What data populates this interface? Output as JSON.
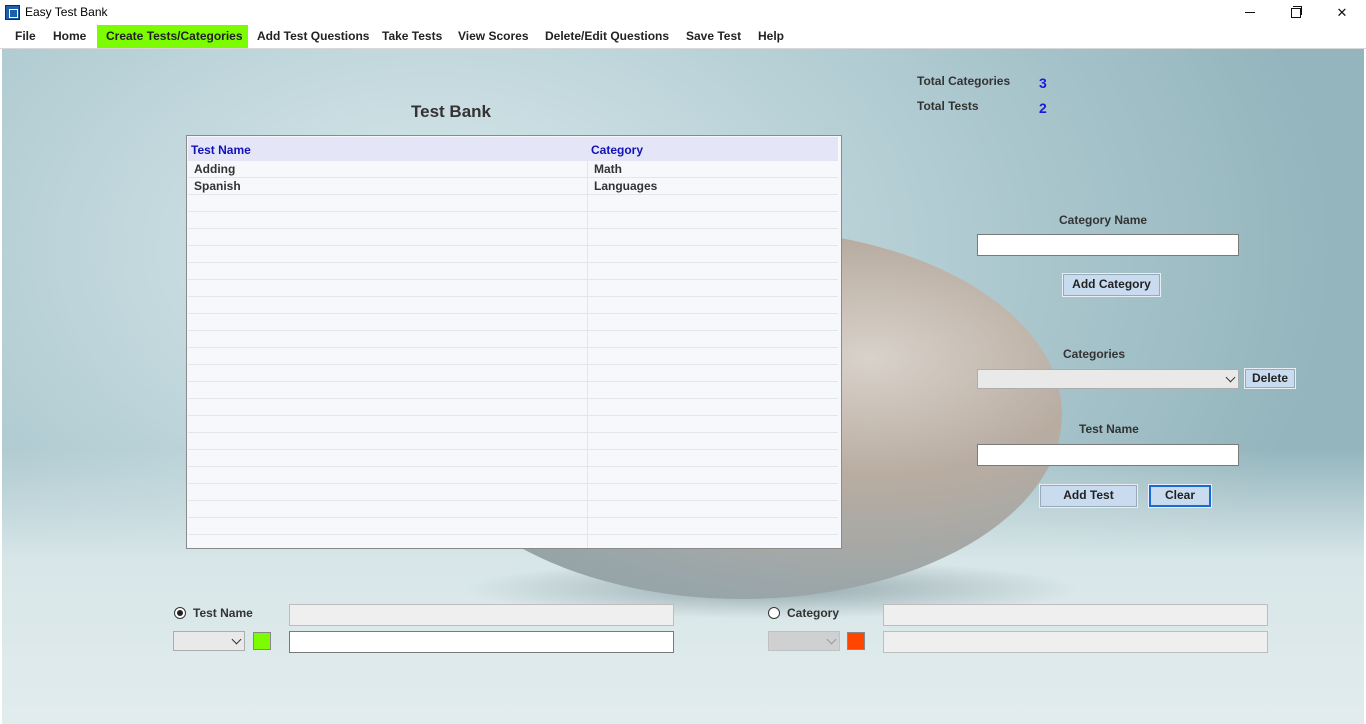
{
  "window": {
    "title": "Easy Test Bank"
  },
  "menu": {
    "items": [
      {
        "label": "File"
      },
      {
        "label": "Home"
      },
      {
        "label": "Create Tests/Categories"
      },
      {
        "label": "Add Test Questions"
      },
      {
        "label": "Take Tests"
      },
      {
        "label": "View Scores"
      },
      {
        "label": "Delete/Edit Questions"
      },
      {
        "label": "Save Test"
      },
      {
        "label": "Help"
      }
    ],
    "active": "Create Tests/Categories"
  },
  "stats": {
    "total_categories_label": "Total Categories",
    "total_categories_value": "3",
    "total_tests_label": "Total Tests",
    "total_tests_value": "2"
  },
  "test_bank": {
    "heading": "Test Bank",
    "columns": [
      "Test Name",
      "Category"
    ],
    "rows": [
      [
        "Adding",
        "Math"
      ],
      [
        "Spanish",
        "Languages"
      ]
    ]
  },
  "form": {
    "category_name_label": "Category Name",
    "category_name_value": "",
    "add_category_label": "Add Category",
    "categories_label": "Categories",
    "categories_selected": "",
    "delete_label": "Delete",
    "test_name_label": "Test Name",
    "test_name_value": "",
    "add_test_label": "Add Test",
    "clear_label": "Clear"
  },
  "search": {
    "test_name_radio_label": "Test Name",
    "test_name_selected": true,
    "category_radio_label": "Category",
    "category_selected": false,
    "test_color": "#7cfc00",
    "category_color": "#ff4500"
  },
  "colors": {
    "active_menu": "#7cfc00",
    "stat_value": "#1a1adb",
    "grid_header_text": "#1212b8"
  }
}
